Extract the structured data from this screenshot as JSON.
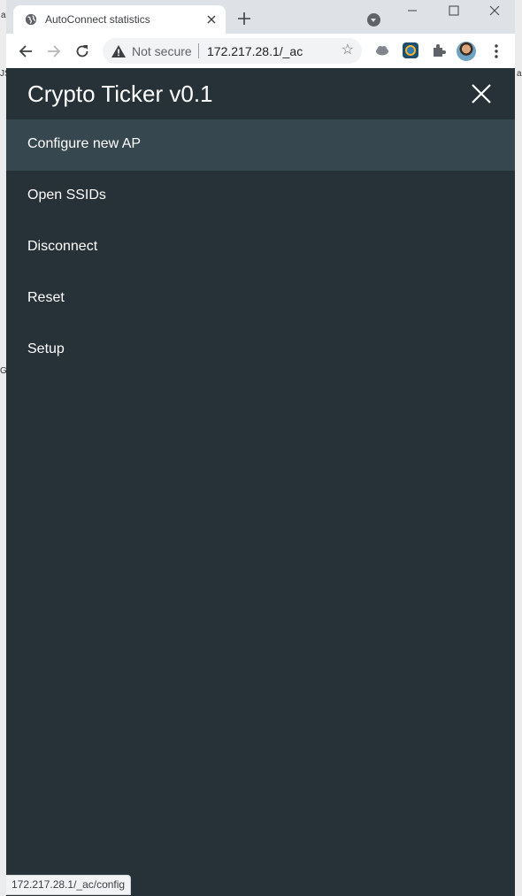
{
  "browser": {
    "tab_title": "AutoConnect statistics",
    "security_label": "Not secure",
    "url": "172.217.28.1/_ac",
    "status_url": "172.217.28.1/_ac/config",
    "edge_left_fragments": [
      "a",
      "JS",
      "G"
    ],
    "edge_right_fragments": [
      "a"
    ]
  },
  "menu": {
    "title": "Crypto Ticker v0.1",
    "items": [
      {
        "label": "Configure new AP",
        "active": true
      },
      {
        "label": "Open SSIDs",
        "active": false
      },
      {
        "label": "Disconnect",
        "active": false
      },
      {
        "label": "Reset",
        "active": false
      },
      {
        "label": "Setup",
        "active": false
      }
    ]
  },
  "colors": {
    "menu_background": "#263238",
    "menu_active": "#37474f",
    "menu_text": "#ffffff"
  }
}
